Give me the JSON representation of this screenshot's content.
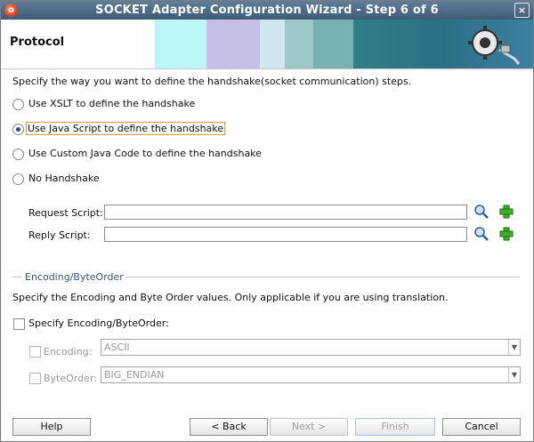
{
  "window": {
    "title": "SOCKET Adapter Configuration Wizard - Step 6 of 6",
    "close_glyph": "×"
  },
  "header": {
    "step_title": "Protocol"
  },
  "intro": "Specify the way you want to define the handshake(socket communication) steps.",
  "handshake_options": [
    {
      "label": "Use XSLT to define the handshake",
      "selected": false
    },
    {
      "label": "Use Java Script to define the handshake",
      "selected": true
    },
    {
      "label": "Use Custom Java Code to define the handshake",
      "selected": false
    },
    {
      "label": "No Handshake",
      "selected": false
    }
  ],
  "scripts": {
    "request_label": "Request Script:",
    "request_value": "",
    "reply_label": "Reply Script:",
    "reply_value": ""
  },
  "encoding_section": {
    "heading": "Encoding/ByteOrder",
    "description": "Specify the Encoding and Byte Order values. Only applicable if you are using translation.",
    "specify_label": "Specify Encoding/ByteOrder:",
    "encoding_label": "Encoding:",
    "encoding_value": "ASCII",
    "byteorder_label": "ByteOrder:",
    "byteorder_value": "BIG_ENDIAN"
  },
  "buttons": {
    "help": "Help",
    "back": "< Back",
    "next": "Next >",
    "finish": "Finish",
    "cancel": "Cancel"
  },
  "icons": {
    "app": "oracle-logo-icon",
    "search": "search-icon",
    "add": "add-icon",
    "header_graphic": "plug-gear-icon"
  }
}
